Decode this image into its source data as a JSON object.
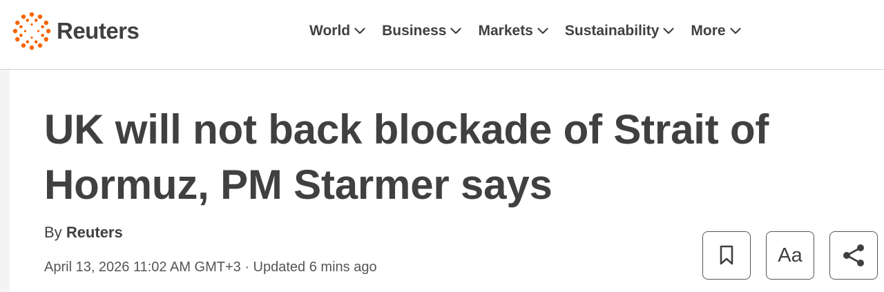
{
  "brand": {
    "name": "Reuters",
    "accent_color": "#fa6400"
  },
  "nav": {
    "items": [
      {
        "label": "World",
        "icon": "chevron-down-icon"
      },
      {
        "label": "Business",
        "icon": "chevron-down-icon"
      },
      {
        "label": "Markets",
        "icon": "chevron-down-icon"
      },
      {
        "label": "Sustainability",
        "icon": "chevron-down-icon"
      },
      {
        "label": "More",
        "icon": "chevron-down-icon"
      }
    ]
  },
  "article": {
    "headline": "UK will not back blockade of Strait of Hormuz, PM Starmer says",
    "byline_prefix": "By",
    "author": "Reuters",
    "dateline": "April 13, 2026 11:02 AM GMT+3 · Updated 6 mins ago"
  },
  "toolbar": {
    "bookmark_icon": "bookmark-icon",
    "font_size_label": "Aa",
    "share_icon": "share-icon"
  }
}
